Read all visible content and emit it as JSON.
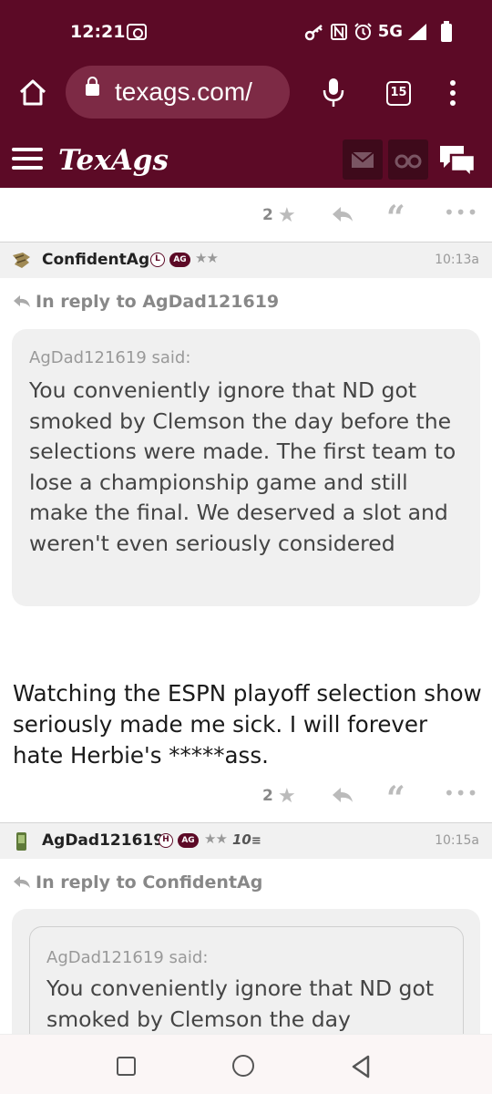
{
  "status_bar": {
    "time": "12:21",
    "network": "5G"
  },
  "browser": {
    "url": "texags.com/",
    "tab_count": "15"
  },
  "site": {
    "logo": "TexAgs",
    "brand_color": "#5c0a26"
  },
  "posts": [
    {
      "actions": {
        "star_count": "2"
      }
    },
    {
      "username": "ConfidentAg",
      "badges": {
        "circle": "L",
        "ag": "AG",
        "stars": "★★"
      },
      "time": "10:13a",
      "in_reply_to": "In reply to AgDad121619",
      "quote": {
        "said": "AgDad121619 said:",
        "text": "You conveniently ignore that ND got smoked by Clemson the day before the selections were made. The first team to lose a championship game and still make the final. We deserved a slot and weren't even seriously considered"
      },
      "body": "Watching the ESPN playoff selection show seriously made me sick. I will forever hate Herbie's *****ass.",
      "actions": {
        "star_count": "2"
      }
    },
    {
      "username": "AgDad121619",
      "badges": {
        "circle": "H",
        "ag": "AG",
        "stars": "★★",
        "ten": "10"
      },
      "time": "10:15a",
      "in_reply_to": "In reply to ConfidentAg",
      "quote": {
        "said": "AgDad121619 said:",
        "text": "You conveniently ignore that ND got smoked by Clemson the day"
      }
    }
  ]
}
